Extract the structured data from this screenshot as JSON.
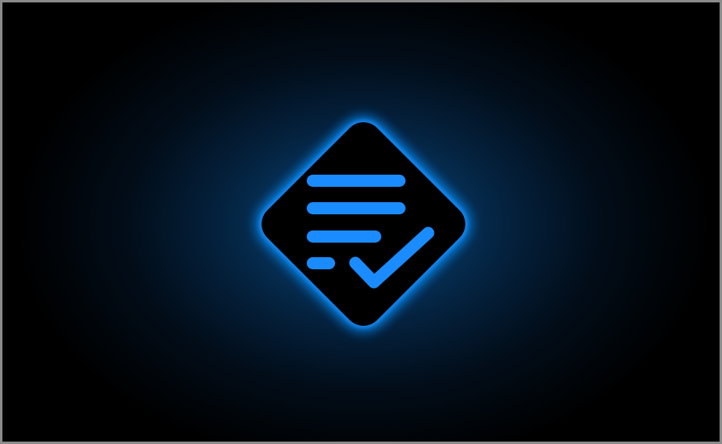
{
  "logo": {
    "icon": "document-check-icon",
    "accent_color": "#1a8cff",
    "glow_color": "#1e90ff",
    "shape_fill": "#000000"
  }
}
